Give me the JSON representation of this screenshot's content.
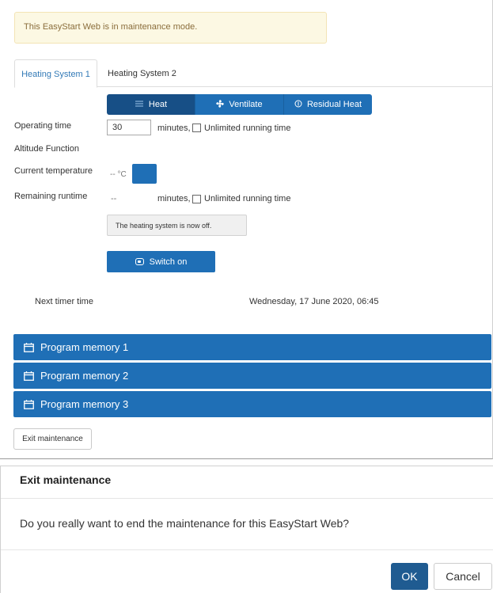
{
  "alert": {
    "text": "This EasyStart Web is in maintenance mode."
  },
  "tabs": [
    {
      "label": "Heating System 1",
      "active": true
    },
    {
      "label": "Heating System 2",
      "active": false
    }
  ],
  "modes": [
    {
      "label": "Heat",
      "icon": "heat-icon",
      "active": true
    },
    {
      "label": "Ventilate",
      "icon": "fan-icon",
      "active": false
    },
    {
      "label": "Residual Heat",
      "icon": "residual-heat-icon",
      "active": false
    }
  ],
  "operating_time": {
    "label": "Operating time",
    "value": "30",
    "unit": "minutes,",
    "unlimited_label": "Unlimited running time",
    "unlimited_checked": false
  },
  "altitude": {
    "label": "Altitude Function"
  },
  "current_temperature": {
    "label": "Current temperature",
    "value": "-- °C"
  },
  "remaining_runtime": {
    "label": "Remaining runtime",
    "value": "--",
    "unit": "minutes,",
    "unlimited_label": "Unlimited running time",
    "unlimited_checked": false
  },
  "status": {
    "text": "The heating system is now off."
  },
  "switch_button": {
    "label": "Switch on"
  },
  "next_timer": {
    "label": "Next timer time",
    "value": "Wednesday, 17 June 2020, 06:45"
  },
  "program_memories": [
    {
      "label": "Program memory 1"
    },
    {
      "label": "Program memory 2"
    },
    {
      "label": "Program memory 3"
    }
  ],
  "exit_button": {
    "label": "Exit maintenance"
  },
  "modal": {
    "title": "Exit maintenance",
    "body": "Do you really want to end the maintenance for this EasyStart Web?",
    "ok_label": "OK",
    "cancel_label": "Cancel"
  },
  "colors": {
    "primary": "#1f6fb6",
    "primary_dark": "#174f86",
    "alert_bg": "#fcf8e3",
    "alert_text": "#8a6d3b"
  }
}
